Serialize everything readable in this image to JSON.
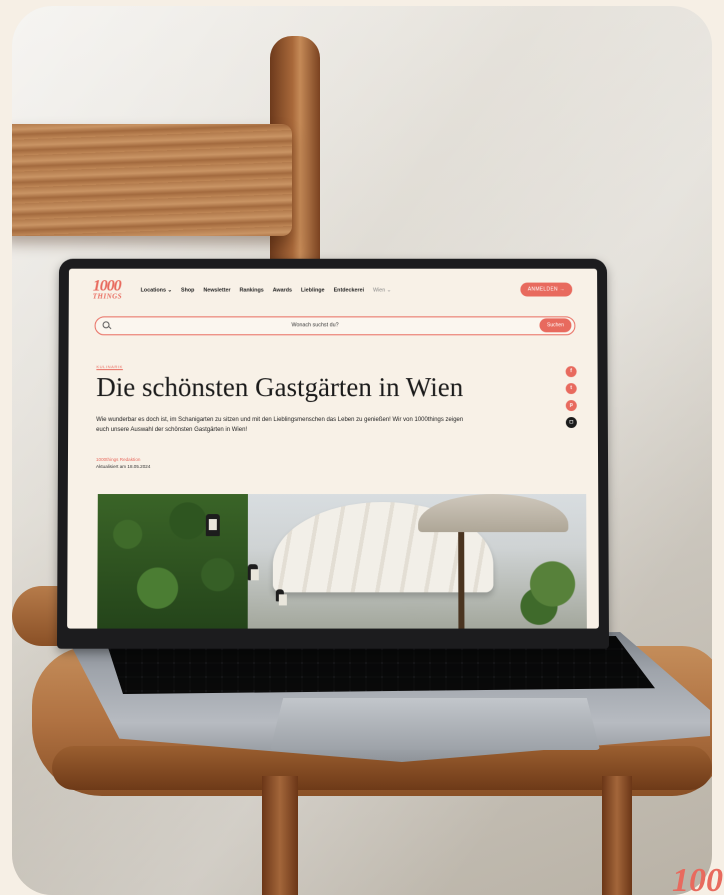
{
  "site": {
    "logo": {
      "number": "1000",
      "word": "THINGS"
    },
    "nav": {
      "items": [
        "Locations ⌄",
        "Shop",
        "Newsletter",
        "Rankings",
        "Awards",
        "Lieblinge",
        "Entdeckerei"
      ],
      "city": "Wien ⌄",
      "login": "ANMELDEN →"
    },
    "search": {
      "placeholder": "Wonach suchst du?",
      "button": "Suchen"
    },
    "article": {
      "category": "KULINARIK",
      "title": "Die schönsten Gastgärten in Wien",
      "lead": "Wie wunderbar es doch ist, im Schanigarten zu sitzen und mit den Lieblingsmenschen das Leben zu genießen! Wir von 1000things zeigen euch unsere Auswahl der schönsten Gastgärten in Wien!",
      "author": "1000things Redaktion",
      "updated": "Aktualisiert am 18.05.2024"
    },
    "share": [
      "f",
      "t",
      "p",
      "◻"
    ]
  },
  "corner_brand": "100",
  "colors": {
    "accent": "#e86a5e",
    "background": "#f8f1e7",
    "text": "#1b1b1b"
  }
}
